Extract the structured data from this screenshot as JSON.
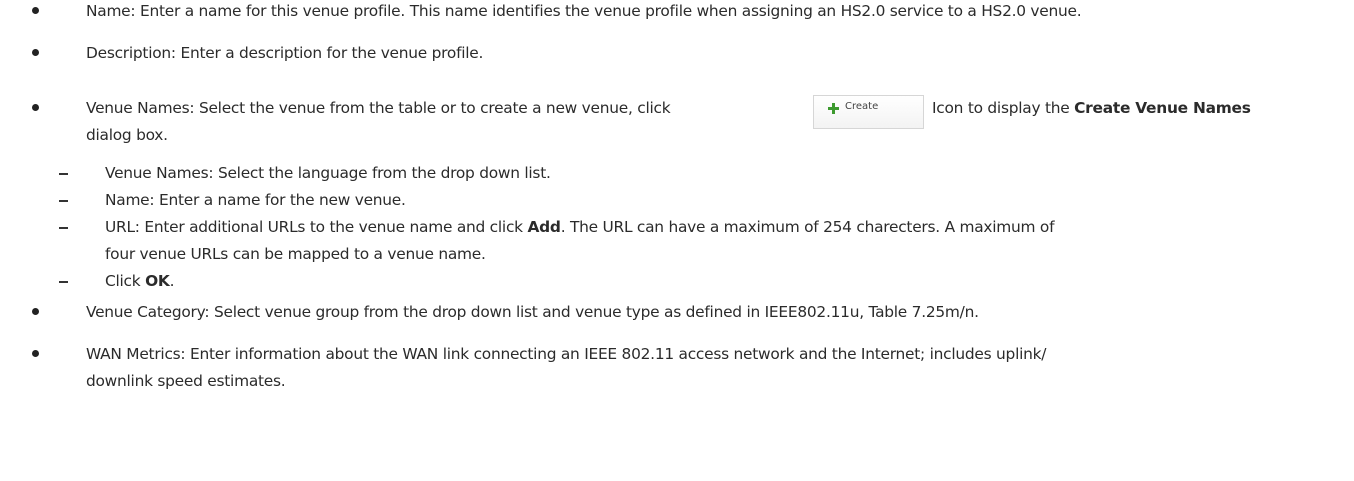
{
  "items": [
    {
      "label": "Name:",
      "text": "Enter a name for this venue profile. This name identifies the venue profile when assigning an HS2.0 service to a HS2.0 venue."
    },
    {
      "label": "Description:",
      "text": "Enter a description for the venue profile."
    },
    {
      "label": "Venue Names:",
      "text_before_button": "Select the venue from the table or to create a new venue, click",
      "text_after_button": "Icon to display the",
      "bold_target": "Create Venue Names",
      "text_end": "dialog box.",
      "create_button": {
        "label": "Create",
        "icon": "plus-icon"
      },
      "sub_items": [
        {
          "label": "Venue Names:",
          "text": "Select the language from the drop down list."
        },
        {
          "label": "Name:",
          "text": "Enter a name for the new venue."
        },
        {
          "label": "URL:",
          "text_before": "Enter additional URLs to the venue name and click",
          "bold": "Add",
          "text_after": ". The URL can have a maximum of 254 charecters. A maximum of",
          "text_line2": "four venue URLs can be mapped to a venue name."
        },
        {
          "text_before": "Click",
          "bold": "OK",
          "text_after": "."
        }
      ]
    },
    {
      "label": "Venue Category:",
      "text": "Select venue group from the drop down list and venue type as defined in IEEE802.11u, Table 7.25m/n."
    },
    {
      "label": "WAN Metrics:",
      "text": "Enter information about the WAN link connecting an IEEE 802.11 access network and the Internet; includes uplink/",
      "text_line2": "downlink speed estimates."
    }
  ]
}
